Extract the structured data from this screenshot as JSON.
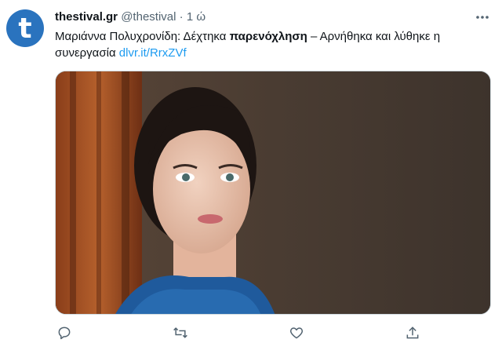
{
  "tweet": {
    "avatar_letter": "t",
    "display_name": "thestival.gr",
    "handle": "@thestival",
    "separator": "·",
    "time": "1 ώ",
    "text_before_bold": "Μαριάννα Πολυχρονίδη: Δέχτηκα ",
    "text_bold": "παρενόχληση",
    "text_after_bold": " – Αρνήθηκα και λύθηκε η συνεργασία ",
    "link_text": "dlvr.it/RrxZVf"
  },
  "icons": {
    "more": "more-dots-icon",
    "reply": "reply-icon",
    "retweet": "retweet-icon",
    "like": "like-icon",
    "share": "share-icon"
  },
  "colors": {
    "avatar_bg": "#2a73be",
    "link": "#1d9bf0",
    "secondary_text": "#536471",
    "icon": "#536471"
  }
}
